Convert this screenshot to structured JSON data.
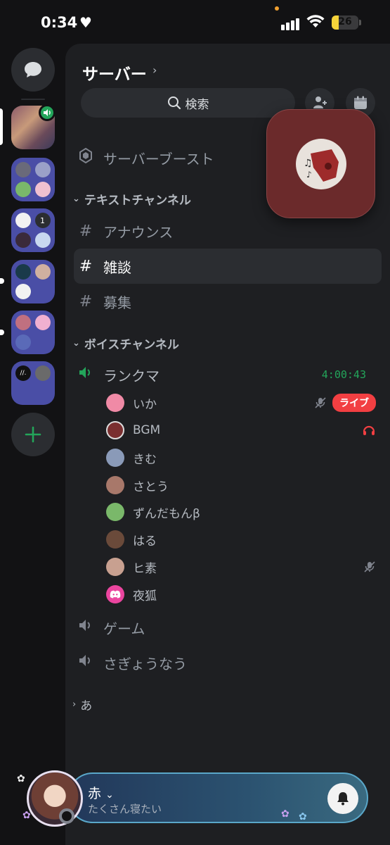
{
  "status_bar": {
    "time": "0:34",
    "battery": "26"
  },
  "server": {
    "name": "サーバー",
    "search_label": "検索",
    "boost_label": "サーバーブースト"
  },
  "rail": {
    "folder_badge": "1"
  },
  "categories": {
    "text": "テキストチャンネル",
    "voice": "ボイスチャンネル",
    "collapsed": "あ"
  },
  "text_channels": [
    {
      "name": "アナウンス"
    },
    {
      "name": "雑談",
      "selected": true
    },
    {
      "name": "募集"
    }
  ],
  "voice_channels": [
    {
      "name": "ランクマ",
      "timer": "4:00:43",
      "active": true
    },
    {
      "name": "ゲーム"
    },
    {
      "name": "さぎょうなう"
    }
  ],
  "voice_members": [
    {
      "name": "いか",
      "live_label": "ライブ",
      "muted": true,
      "avatar_color": "#f08aa6"
    },
    {
      "name": "BGM",
      "activity_icon": "headset-activity-icon",
      "avatar_color": "#7a2f30"
    },
    {
      "name": "きむ",
      "avatar_color": "#8a9ab8"
    },
    {
      "name": "さとう",
      "avatar_color": "#a8786a"
    },
    {
      "name": "ずんだもんβ",
      "avatar_color": "#7ab86a"
    },
    {
      "name": "はる",
      "avatar_color": "#6a4a3a"
    },
    {
      "name": "ヒ素",
      "muted": true,
      "avatar_color": "#c8a090"
    },
    {
      "name": "夜狐",
      "avatar_color": "#eb459f"
    }
  ],
  "user": {
    "name": "赤",
    "status": "たくさん寝たい"
  },
  "colors": {
    "accent_green": "#23a55a",
    "live_red": "#f23f42",
    "background": "#1e1f22"
  }
}
